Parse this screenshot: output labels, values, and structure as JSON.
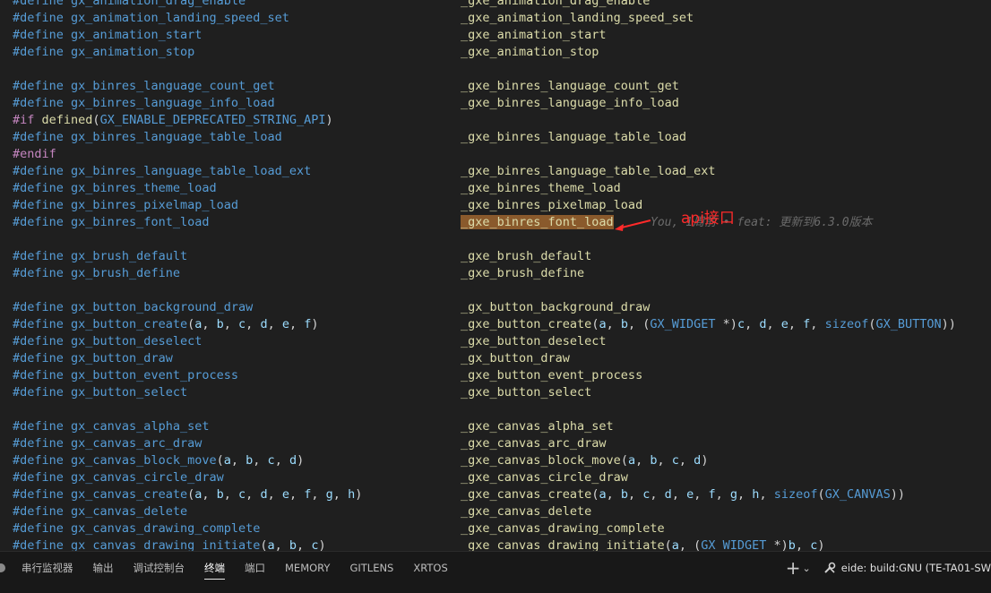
{
  "code_lines": [
    [
      {
        "t": "#define",
        "c": "dir"
      },
      {
        "t": " gx_animation_drag_enable",
        "c": "mac"
      }
    ],
    [
      {
        "t": "#define",
        "c": "dir"
      },
      {
        "t": " gx_animation_landing_speed_set",
        "c": "mac"
      }
    ],
    [
      {
        "t": "#define",
        "c": "dir"
      },
      {
        "t": " gx_animation_start",
        "c": "mac"
      }
    ],
    [
      {
        "t": "#define",
        "c": "dir"
      },
      {
        "t": " gx_animation_stop",
        "c": "mac"
      }
    ],
    [],
    [
      {
        "t": "#define",
        "c": "dir"
      },
      {
        "t": " gx_binres_language_count_get",
        "c": "mac"
      }
    ],
    [
      {
        "t": "#define",
        "c": "dir"
      },
      {
        "t": " gx_binres_language_info_load",
        "c": "mac"
      }
    ],
    [
      {
        "t": "#if",
        "c": "kw"
      },
      {
        "t": " defined",
        "c": "fn"
      },
      {
        "t": "(",
        "c": "p"
      },
      {
        "t": "GX_ENABLE_DEPRECATED_STRING_API",
        "c": "mac"
      },
      {
        "t": ")",
        "c": "p"
      }
    ],
    [
      {
        "t": "#define",
        "c": "dir"
      },
      {
        "t": " gx_binres_language_table_load",
        "c": "mac"
      }
    ],
    [
      {
        "t": "#endif",
        "c": "kw"
      }
    ],
    [
      {
        "t": "#define",
        "c": "dir"
      },
      {
        "t": " gx_binres_language_table_load_ext",
        "c": "mac"
      }
    ],
    [
      {
        "t": "#define",
        "c": "dir"
      },
      {
        "t": " gx_binres_theme_load",
        "c": "mac"
      }
    ],
    [
      {
        "t": "#define",
        "c": "dir"
      },
      {
        "t": " gx_binres_pixelmap_load",
        "c": "mac"
      }
    ],
    [
      {
        "t": "#define",
        "c": "dir"
      },
      {
        "t": " gx_binres_font_load",
        "c": "mac"
      }
    ],
    [],
    [
      {
        "t": "#define",
        "c": "dir"
      },
      {
        "t": " gx_brush_default",
        "c": "mac"
      }
    ],
    [
      {
        "t": "#define",
        "c": "dir"
      },
      {
        "t": " gx_brush_define",
        "c": "mac"
      }
    ],
    [],
    [
      {
        "t": "#define",
        "c": "dir"
      },
      {
        "t": " gx_button_background_draw",
        "c": "mac"
      }
    ],
    [
      {
        "t": "#define",
        "c": "dir"
      },
      {
        "t": " gx_button_create",
        "c": "mac"
      },
      {
        "t": "(",
        "c": "p"
      },
      {
        "t": "a",
        "c": "var"
      },
      {
        "t": ", ",
        "c": "p"
      },
      {
        "t": "b",
        "c": "var"
      },
      {
        "t": ", ",
        "c": "p"
      },
      {
        "t": "c",
        "c": "var"
      },
      {
        "t": ", ",
        "c": "p"
      },
      {
        "t": "d",
        "c": "var"
      },
      {
        "t": ", ",
        "c": "p"
      },
      {
        "t": "e",
        "c": "var"
      },
      {
        "t": ", ",
        "c": "p"
      },
      {
        "t": "f",
        "c": "var"
      },
      {
        "t": ")",
        "c": "p"
      }
    ],
    [
      {
        "t": "#define",
        "c": "dir"
      },
      {
        "t": " gx_button_deselect",
        "c": "mac"
      }
    ],
    [
      {
        "t": "#define",
        "c": "dir"
      },
      {
        "t": " gx_button_draw",
        "c": "mac"
      }
    ],
    [
      {
        "t": "#define",
        "c": "dir"
      },
      {
        "t": " gx_button_event_process",
        "c": "mac"
      }
    ],
    [
      {
        "t": "#define",
        "c": "dir"
      },
      {
        "t": " gx_button_select",
        "c": "mac"
      }
    ],
    [],
    [
      {
        "t": "#define",
        "c": "dir"
      },
      {
        "t": " gx_canvas_alpha_set",
        "c": "mac"
      }
    ],
    [
      {
        "t": "#define",
        "c": "dir"
      },
      {
        "t": " gx_canvas_arc_draw",
        "c": "mac"
      }
    ],
    [
      {
        "t": "#define",
        "c": "dir"
      },
      {
        "t": " gx_canvas_block_move",
        "c": "mac"
      },
      {
        "t": "(",
        "c": "p"
      },
      {
        "t": "a",
        "c": "var"
      },
      {
        "t": ", ",
        "c": "p"
      },
      {
        "t": "b",
        "c": "var"
      },
      {
        "t": ", ",
        "c": "p"
      },
      {
        "t": "c",
        "c": "var"
      },
      {
        "t": ", ",
        "c": "p"
      },
      {
        "t": "d",
        "c": "var"
      },
      {
        "t": ")",
        "c": "p"
      }
    ],
    [
      {
        "t": "#define",
        "c": "dir"
      },
      {
        "t": " gx_canvas_circle_draw",
        "c": "mac"
      }
    ],
    [
      {
        "t": "#define",
        "c": "dir"
      },
      {
        "t": " gx_canvas_create",
        "c": "mac"
      },
      {
        "t": "(",
        "c": "p"
      },
      {
        "t": "a",
        "c": "var"
      },
      {
        "t": ", ",
        "c": "p"
      },
      {
        "t": "b",
        "c": "var"
      },
      {
        "t": ", ",
        "c": "p"
      },
      {
        "t": "c",
        "c": "var"
      },
      {
        "t": ", ",
        "c": "p"
      },
      {
        "t": "d",
        "c": "var"
      },
      {
        "t": ", ",
        "c": "p"
      },
      {
        "t": "e",
        "c": "var"
      },
      {
        "t": ", ",
        "c": "p"
      },
      {
        "t": "f",
        "c": "var"
      },
      {
        "t": ", ",
        "c": "p"
      },
      {
        "t": "g",
        "c": "var"
      },
      {
        "t": ", ",
        "c": "p"
      },
      {
        "t": "h",
        "c": "var"
      },
      {
        "t": ")",
        "c": "p"
      }
    ],
    [
      {
        "t": "#define",
        "c": "dir"
      },
      {
        "t": " gx_canvas_delete",
        "c": "mac"
      }
    ],
    [
      {
        "t": "#define",
        "c": "dir"
      },
      {
        "t": " gx_canvas_drawing_complete",
        "c": "mac"
      }
    ],
    [
      {
        "t": "#define",
        "c": "dir"
      },
      {
        "t": " gx_canvas_drawing_initiate",
        "c": "mac"
      },
      {
        "t": "(",
        "c": "p"
      },
      {
        "t": "a",
        "c": "var"
      },
      {
        "t": ", ",
        "c": "p"
      },
      {
        "t": "b",
        "c": "var"
      },
      {
        "t": ", ",
        "c": "p"
      },
      {
        "t": "c",
        "c": "var"
      },
      {
        "t": ")",
        "c": "p"
      }
    ]
  ],
  "code_targets": [
    [
      {
        "t": "_gxe_animation_drag_enable",
        "c": "tgt"
      }
    ],
    [
      {
        "t": "_gxe_animation_landing_speed_set",
        "c": "tgt"
      }
    ],
    [
      {
        "t": "_gxe_animation_start",
        "c": "tgt"
      }
    ],
    [
      {
        "t": "_gxe_animation_stop",
        "c": "tgt"
      }
    ],
    [],
    [
      {
        "t": "_gxe_binres_language_count_get",
        "c": "tgt"
      }
    ],
    [
      {
        "t": "_gxe_binres_language_info_load",
        "c": "tgt"
      }
    ],
    [],
    [
      {
        "t": "_gxe_binres_language_table_load",
        "c": "tgt"
      }
    ],
    [],
    [
      {
        "t": "_gxe_binres_language_table_load_ext",
        "c": "tgt"
      }
    ],
    [
      {
        "t": "_gxe_binres_theme_load",
        "c": "tgt"
      }
    ],
    [
      {
        "t": "_gxe_binres_pixelmap_load",
        "c": "tgt"
      }
    ],
    [
      {
        "t": "_gxe_binres_font_load",
        "c": "tgt hl"
      }
    ],
    [],
    [
      {
        "t": "_gxe_brush_default",
        "c": "tgt"
      }
    ],
    [
      {
        "t": "_gxe_brush_define",
        "c": "tgt"
      }
    ],
    [],
    [
      {
        "t": "_gx_button_background_draw",
        "c": "tgt"
      }
    ],
    [
      {
        "t": "_gxe_button_create",
        "c": "tgt"
      },
      {
        "t": "(",
        "c": "p"
      },
      {
        "t": "a",
        "c": "var"
      },
      {
        "t": ", ",
        "c": "p"
      },
      {
        "t": "b",
        "c": "var"
      },
      {
        "t": ", (",
        "c": "p"
      },
      {
        "t": "GX_WIDGET",
        "c": "mac"
      },
      {
        "t": " *)",
        "c": "p"
      },
      {
        "t": "c",
        "c": "var"
      },
      {
        "t": ", ",
        "c": "p"
      },
      {
        "t": "d",
        "c": "var"
      },
      {
        "t": ", ",
        "c": "p"
      },
      {
        "t": "e",
        "c": "var"
      },
      {
        "t": ", ",
        "c": "p"
      },
      {
        "t": "f",
        "c": "var"
      },
      {
        "t": ", ",
        "c": "p"
      },
      {
        "t": "sizeof",
        "c": "dir"
      },
      {
        "t": "(",
        "c": "p"
      },
      {
        "t": "GX_BUTTON",
        "c": "mac"
      },
      {
        "t": "))",
        "c": "p"
      }
    ],
    [
      {
        "t": "_gxe_button_deselect",
        "c": "tgt"
      }
    ],
    [
      {
        "t": "_gx_button_draw",
        "c": "tgt"
      }
    ],
    [
      {
        "t": "_gxe_button_event_process",
        "c": "tgt"
      }
    ],
    [
      {
        "t": "_gxe_button_select",
        "c": "tgt"
      }
    ],
    [],
    [
      {
        "t": "_gxe_canvas_alpha_set",
        "c": "tgt"
      }
    ],
    [
      {
        "t": "_gxe_canvas_arc_draw",
        "c": "tgt"
      }
    ],
    [
      {
        "t": "_gxe_canvas_block_move",
        "c": "tgt"
      },
      {
        "t": "(",
        "c": "p"
      },
      {
        "t": "a",
        "c": "var"
      },
      {
        "t": ", ",
        "c": "p"
      },
      {
        "t": "b",
        "c": "var"
      },
      {
        "t": ", ",
        "c": "p"
      },
      {
        "t": "c",
        "c": "var"
      },
      {
        "t": ", ",
        "c": "p"
      },
      {
        "t": "d",
        "c": "var"
      },
      {
        "t": ")",
        "c": "p"
      }
    ],
    [
      {
        "t": "_gxe_canvas_circle_draw",
        "c": "tgt"
      }
    ],
    [
      {
        "t": "_gxe_canvas_create",
        "c": "tgt"
      },
      {
        "t": "(",
        "c": "p"
      },
      {
        "t": "a",
        "c": "var"
      },
      {
        "t": ", ",
        "c": "p"
      },
      {
        "t": "b",
        "c": "var"
      },
      {
        "t": ", ",
        "c": "p"
      },
      {
        "t": "c",
        "c": "var"
      },
      {
        "t": ", ",
        "c": "p"
      },
      {
        "t": "d",
        "c": "var"
      },
      {
        "t": ", ",
        "c": "p"
      },
      {
        "t": "e",
        "c": "var"
      },
      {
        "t": ", ",
        "c": "p"
      },
      {
        "t": "f",
        "c": "var"
      },
      {
        "t": ", ",
        "c": "p"
      },
      {
        "t": "g",
        "c": "var"
      },
      {
        "t": ", ",
        "c": "p"
      },
      {
        "t": "h",
        "c": "var"
      },
      {
        "t": ", ",
        "c": "p"
      },
      {
        "t": "sizeof",
        "c": "dir"
      },
      {
        "t": "(",
        "c": "p"
      },
      {
        "t": "GX_CANVAS",
        "c": "mac"
      },
      {
        "t": "))",
        "c": "p"
      }
    ],
    [
      {
        "t": "_gxe_canvas_delete",
        "c": "tgt"
      }
    ],
    [
      {
        "t": "_gxe_canvas_drawing_complete",
        "c": "tgt"
      }
    ],
    [
      {
        "t": "_gxe_canvas_drawing_initiate",
        "c": "tgt"
      },
      {
        "t": "(",
        "c": "p"
      },
      {
        "t": "a",
        "c": "var"
      },
      {
        "t": ", (",
        "c": "p"
      },
      {
        "t": "GX_WIDGET",
        "c": "mac"
      },
      {
        "t": " *)",
        "c": "p"
      },
      {
        "t": "b",
        "c": "var"
      },
      {
        "t": ", ",
        "c": "p"
      },
      {
        "t": "c",
        "c": "var"
      },
      {
        "t": ")",
        "c": "p"
      }
    ]
  ],
  "blame_hint": {
    "line_index": 13,
    "text": "You, 1周前 • feat: 更新到6.3.0版本"
  },
  "annotation": {
    "text": "api接口",
    "color": "#ff2a2a"
  },
  "panel": {
    "tabs": [
      {
        "label": "串行监视器",
        "active": false
      },
      {
        "label": "输出",
        "active": false
      },
      {
        "label": "调试控制台",
        "active": false
      },
      {
        "label": "终端",
        "active": true
      },
      {
        "label": "端口",
        "active": false
      },
      {
        "label": "MEMORY",
        "active": false
      },
      {
        "label": "GITLENS",
        "active": false
      },
      {
        "label": "XRTOS",
        "active": false
      }
    ],
    "add_icon": "+",
    "chevron_icon": "⌄",
    "status_text": "eide: build:GNU (TE-TA01-SW"
  },
  "colors": {
    "background": "#1f1f1f",
    "highlight": "#8a5a2c",
    "macro": "#569cd6",
    "function": "#dcdcaa",
    "variable": "#9cdcfe",
    "preprocessor": "#c586c0"
  }
}
